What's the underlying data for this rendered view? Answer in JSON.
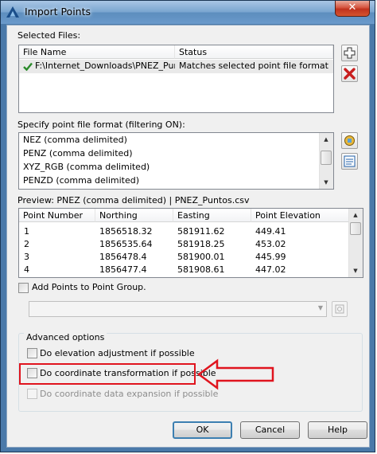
{
  "window": {
    "title": "Import Points",
    "close_glyph": "✕"
  },
  "selected_files": {
    "label": "Selected Files:",
    "columns": [
      "File Name",
      "Status"
    ],
    "rows": [
      {
        "name": "F:\\Internet_Downloads\\PNEZ_Punt...",
        "status": "Matches selected point file format"
      }
    ]
  },
  "file_format": {
    "label": "Specify point file format (filtering ON):",
    "options": [
      "NEZ (comma delimited)",
      "PENZ (comma delimited)",
      "XYZ_RGB (comma delimited)",
      "PENZD (comma delimited)"
    ]
  },
  "preview": {
    "label": "Preview: PNEZ (comma delimited) | PNEZ_Puntos.csv",
    "columns": [
      "Point Number",
      "Northing",
      "Easting",
      "Point Elevation"
    ],
    "rows": [
      [
        "1",
        "1856518.32",
        "581911.62",
        "449.41"
      ],
      [
        "2",
        "1856535.64",
        "581918.25",
        "453.02"
      ],
      [
        "3",
        "1856478.4",
        "581900.01",
        "445.99"
      ],
      [
        "4",
        "1856477.4",
        "581908.61",
        "447.02"
      ]
    ]
  },
  "point_group": {
    "label": "Add Points to Point Group.",
    "value": ""
  },
  "advanced": {
    "title": "Advanced options",
    "elevation_label": "Do elevation adjustment if possible",
    "transform_label": "Do coordinate transformation if possible",
    "expansion_label": "Do coordinate data expansion if possible"
  },
  "buttons": {
    "ok": "OK",
    "cancel": "Cancel",
    "help": "Help"
  },
  "colors": {
    "annotation_red": "#e0141e",
    "check_green": "#2a8a2a"
  }
}
